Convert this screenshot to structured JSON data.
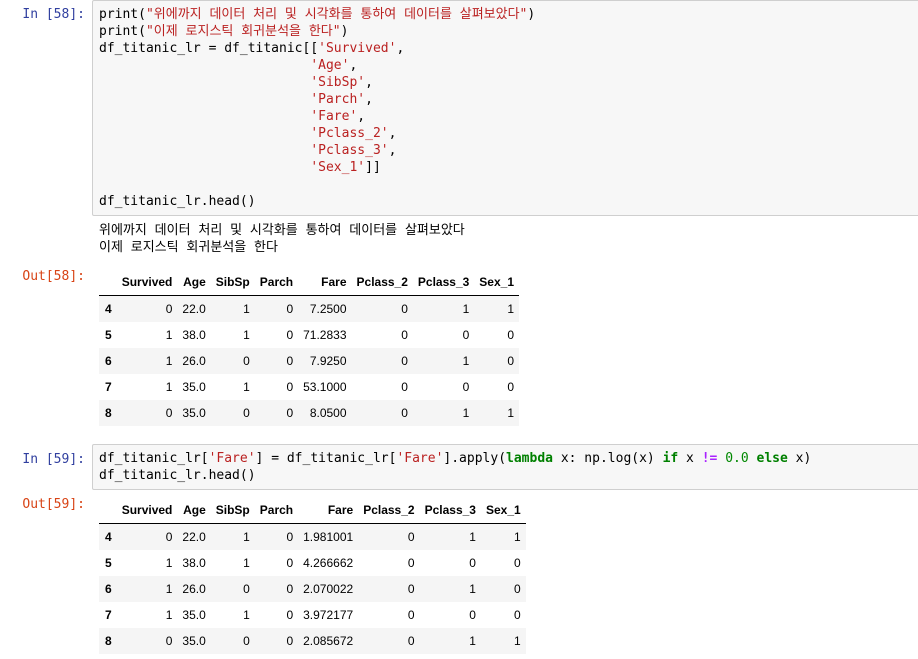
{
  "cell58": {
    "in_prompt": "In [58]:",
    "out_prompt": "Out[58]:",
    "code": [
      {
        "parts": [
          [
            "fn",
            "print("
          ],
          [
            "str",
            "\"위에까지 데이터 처리 및 시각화를 통하여 데이터를 살펴보았다\""
          ],
          [
            "fn",
            ")"
          ]
        ]
      },
      {
        "parts": [
          [
            "fn",
            "print("
          ],
          [
            "str",
            "\"이제 로지스틱 회귀분석을 한다\""
          ],
          [
            "fn",
            ")"
          ]
        ]
      },
      {
        "parts": [
          [
            "fn",
            "df_titanic_lr = df_titanic[["
          ],
          [
            "str",
            "'Survived'"
          ],
          [
            "fn",
            ","
          ]
        ]
      },
      {
        "parts": [
          [
            "fn",
            "                           "
          ],
          [
            "str",
            "'Age'"
          ],
          [
            "fn",
            ","
          ]
        ]
      },
      {
        "parts": [
          [
            "fn",
            "                           "
          ],
          [
            "str",
            "'SibSp'"
          ],
          [
            "fn",
            ","
          ]
        ]
      },
      {
        "parts": [
          [
            "fn",
            "                           "
          ],
          [
            "str",
            "'Parch'"
          ],
          [
            "fn",
            ","
          ]
        ]
      },
      {
        "parts": [
          [
            "fn",
            "                           "
          ],
          [
            "str",
            "'Fare'"
          ],
          [
            "fn",
            ","
          ]
        ]
      },
      {
        "parts": [
          [
            "fn",
            "                           "
          ],
          [
            "str",
            "'Pclass_2'"
          ],
          [
            "fn",
            ","
          ]
        ]
      },
      {
        "parts": [
          [
            "fn",
            "                           "
          ],
          [
            "str",
            "'Pclass_3'"
          ],
          [
            "fn",
            ","
          ]
        ]
      },
      {
        "parts": [
          [
            "fn",
            "                           "
          ],
          [
            "str",
            "'Sex_1'"
          ],
          [
            "fn",
            "]]"
          ]
        ]
      },
      {
        "parts": [
          [
            "fn",
            ""
          ]
        ]
      },
      {
        "parts": [
          [
            "fn",
            "df_titanic_lr.head()"
          ]
        ]
      }
    ],
    "stdout": [
      "위에까지 데이터 처리 및 시각화를 통하여 데이터를 살펴보았다",
      "이제 로지스틱 회귀분석을 한다"
    ],
    "table": {
      "columns": [
        "",
        "Survived",
        "Age",
        "SibSp",
        "Parch",
        "Fare",
        "Pclass_2",
        "Pclass_3",
        "Sex_1"
      ],
      "rows": [
        [
          "4",
          "0",
          "22.0",
          "1",
          "0",
          "7.2500",
          "0",
          "1",
          "1"
        ],
        [
          "5",
          "1",
          "38.0",
          "1",
          "0",
          "71.2833",
          "0",
          "0",
          "0"
        ],
        [
          "6",
          "1",
          "26.0",
          "0",
          "0",
          "7.9250",
          "0",
          "1",
          "0"
        ],
        [
          "7",
          "1",
          "35.0",
          "1",
          "0",
          "53.1000",
          "0",
          "0",
          "0"
        ],
        [
          "8",
          "0",
          "35.0",
          "0",
          "0",
          "8.0500",
          "0",
          "1",
          "1"
        ]
      ]
    }
  },
  "cell59": {
    "in_prompt": "In [59]:",
    "out_prompt": "Out[59]:",
    "code": [
      {
        "parts": [
          [
            "fn",
            "df_titanic_lr["
          ],
          [
            "str",
            "'Fare'"
          ],
          [
            "fn",
            "] = df_titanic_lr["
          ],
          [
            "str",
            "'Fare'"
          ],
          [
            "fn",
            "].apply("
          ],
          [
            "kw",
            "lambda"
          ],
          [
            "fn",
            " x: np.log(x) "
          ],
          [
            "kw",
            "if"
          ],
          [
            "fn",
            " x "
          ],
          [
            "op",
            "!="
          ],
          [
            "fn",
            " "
          ],
          [
            "num",
            "0.0"
          ],
          [
            "fn",
            " "
          ],
          [
            "kw",
            "else"
          ],
          [
            "fn",
            " x)"
          ]
        ]
      },
      {
        "parts": [
          [
            "fn",
            "df_titanic_lr.head()"
          ]
        ]
      }
    ],
    "table": {
      "columns": [
        "",
        "Survived",
        "Age",
        "SibSp",
        "Parch",
        "Fare",
        "Pclass_2",
        "Pclass_3",
        "Sex_1"
      ],
      "rows": [
        [
          "4",
          "0",
          "22.0",
          "1",
          "0",
          "1.981001",
          "0",
          "1",
          "1"
        ],
        [
          "5",
          "1",
          "38.0",
          "1",
          "0",
          "4.266662",
          "0",
          "0",
          "0"
        ],
        [
          "6",
          "1",
          "26.0",
          "0",
          "0",
          "2.070022",
          "0",
          "1",
          "0"
        ],
        [
          "7",
          "1",
          "35.0",
          "1",
          "0",
          "3.972177",
          "0",
          "0",
          "0"
        ],
        [
          "8",
          "0",
          "35.0",
          "0",
          "0",
          "2.085672",
          "0",
          "1",
          "1"
        ]
      ]
    }
  }
}
